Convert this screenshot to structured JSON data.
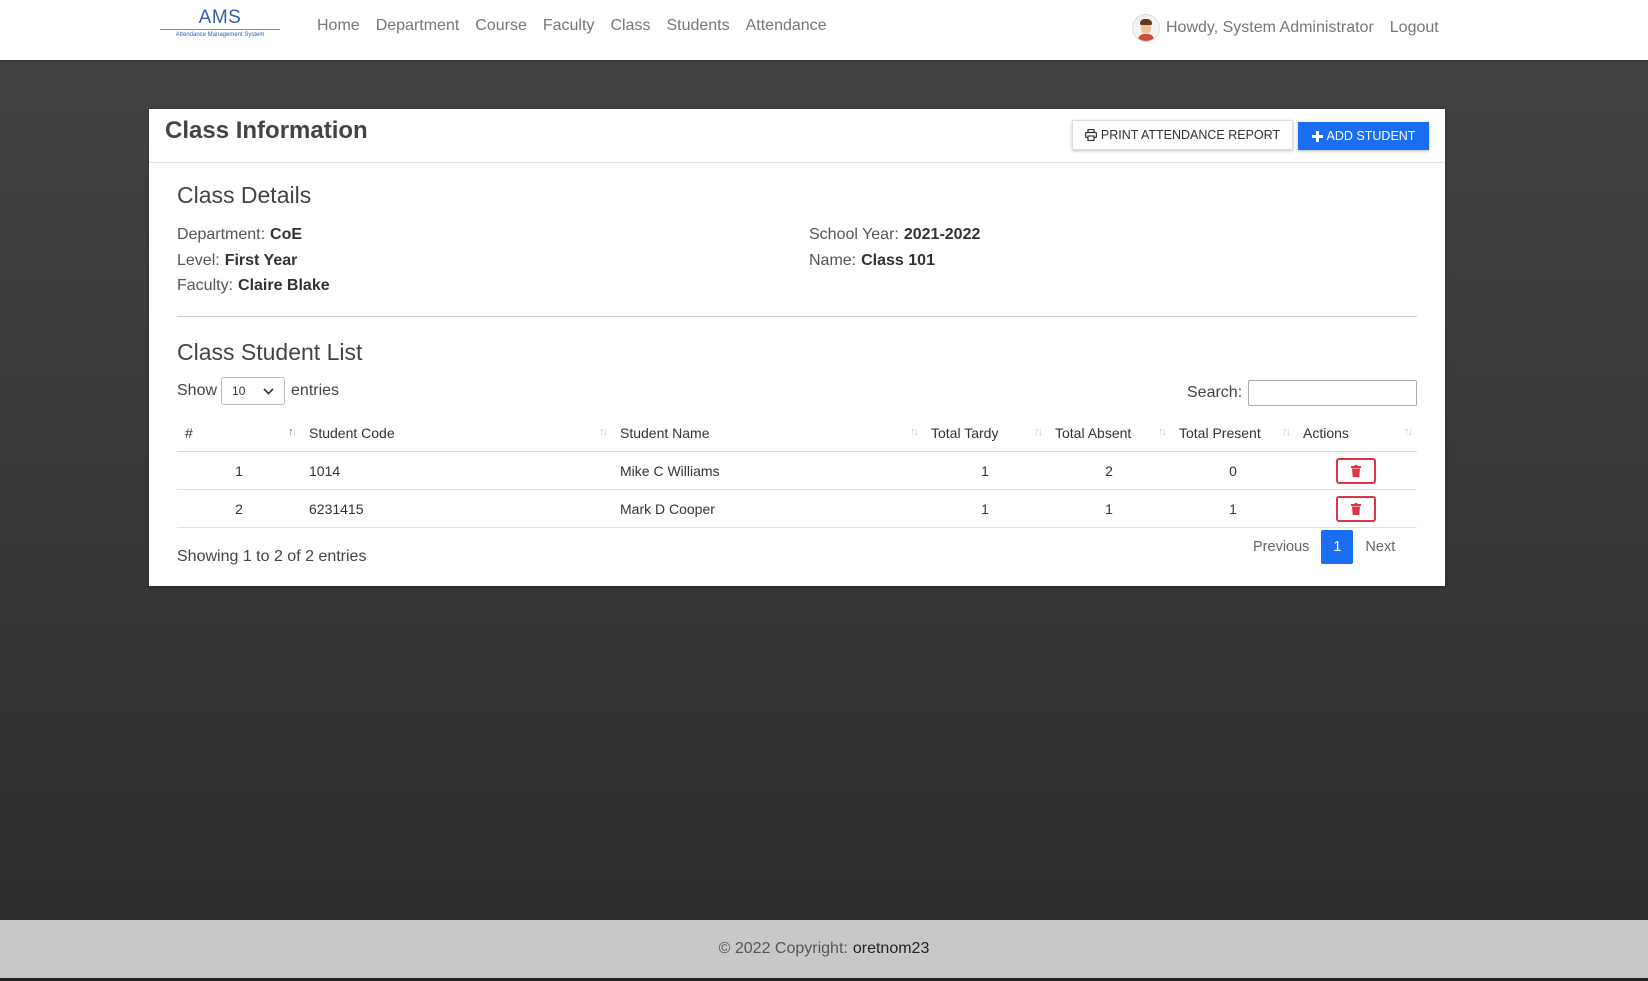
{
  "brand": {
    "title": "AMS",
    "subtitle": "Attendance Management System"
  },
  "nav": [
    "Home",
    "Department",
    "Course",
    "Faculty",
    "Class",
    "Students",
    "Attendance"
  ],
  "user": {
    "greeting": "Howdy, System Administrator",
    "logout": "Logout"
  },
  "page": {
    "title": "Class Information",
    "print_label": "PRINT ATTENDANCE REPORT",
    "add_label": "ADD STUDENT"
  },
  "details": {
    "heading": "Class Details",
    "department_label": "Department:",
    "department": "CoE",
    "level_label": "Level:",
    "level": "First Year",
    "faculty_label": "Faculty:",
    "faculty": "Claire Blake",
    "school_year_label": "School Year:",
    "school_year": "2021-2022",
    "name_label": "Name:",
    "name": "Class 101"
  },
  "list": {
    "heading": "Class Student List",
    "show_label": "Show",
    "entries_value": "10",
    "entries_label": "entries",
    "search_label": "Search:",
    "columns": [
      "#",
      "Student Code",
      "Student Name",
      "Total Tardy",
      "Total Absent",
      "Total Present",
      "Actions"
    ],
    "rows": [
      {
        "num": "1",
        "code": "1014",
        "name": "Mike C Williams",
        "tardy": "1",
        "absent": "2",
        "present": "0"
      },
      {
        "num": "2",
        "code": "6231415",
        "name": "Mark D Cooper",
        "tardy": "1",
        "absent": "1",
        "present": "1"
      }
    ],
    "info": "Showing 1 to 2 of 2 entries",
    "prev": "Previous",
    "page": "1",
    "next": "Next"
  },
  "footer": {
    "copyright": "© 2022 Copyright:",
    "author": "oretnom23"
  },
  "colors": {
    "primary": "#1a6ef2",
    "danger": "#dc3545",
    "brand": "#2f5fb3"
  }
}
